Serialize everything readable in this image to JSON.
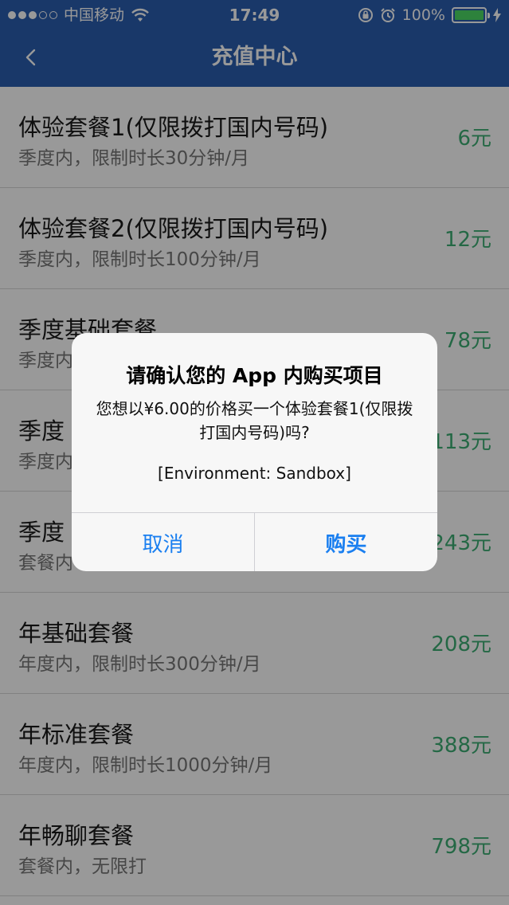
{
  "status_bar": {
    "carrier": "中国移动",
    "time": "17:49",
    "battery": "100%"
  },
  "nav": {
    "title": "充值中心"
  },
  "plans": [
    {
      "title": "体验套餐1(仅限拨打国内号码)",
      "desc": "季度内，限制时长30分钟/月",
      "price": "6元"
    },
    {
      "title": "体验套餐2(仅限拨打国内号码)",
      "desc": "季度内，限制时长100分钟/月",
      "price": "12元"
    },
    {
      "title": "季度基础套餐",
      "desc": "季度内",
      "price": "78元"
    },
    {
      "title": "季度",
      "desc": "季度内",
      "price": "113元"
    },
    {
      "title": "季度",
      "desc": "套餐内",
      "price": "243元"
    },
    {
      "title": "年基础套餐",
      "desc": "年度内，限制时长300分钟/月",
      "price": "208元"
    },
    {
      "title": "年标准套餐",
      "desc": "年度内，限制时长1000分钟/月",
      "price": "388元"
    },
    {
      "title": "年畅聊套餐",
      "desc": "套餐内，无限打",
      "price": "798元"
    }
  ],
  "alert": {
    "title": "请确认您的 App 内购买项目",
    "message": "您想以¥6.00的价格买一个体验套餐1(仅限拨打国内号码)吗?",
    "environment": "[Environment: Sandbox]",
    "cancel_label": "取消",
    "confirm_label": "购买"
  },
  "colors": {
    "nav_bg": "#2b5eb0",
    "price_green": "#3dae74",
    "alert_button_blue": "#1a7ff0",
    "battery_green": "#4cd964"
  }
}
